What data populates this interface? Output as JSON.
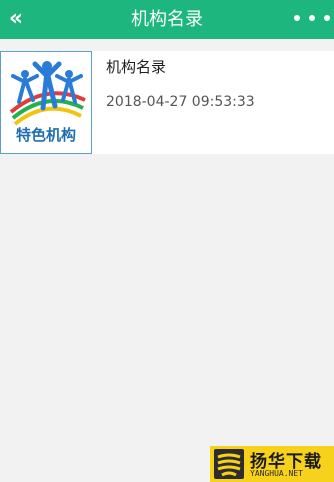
{
  "header": {
    "title": "机构名录",
    "back_icon": "chevron-double-left-icon",
    "more_icon": "more-dots-icon",
    "bg_color": "#1cb67e"
  },
  "list": {
    "items": [
      {
        "thumbnail_label": "特色机构",
        "title": "机构名录",
        "datetime": "2018-04-27 09:53:33"
      }
    ]
  },
  "watermark": {
    "name": "扬华下载",
    "domain": "YANGHUA.NET",
    "color": "#f6d21c"
  }
}
